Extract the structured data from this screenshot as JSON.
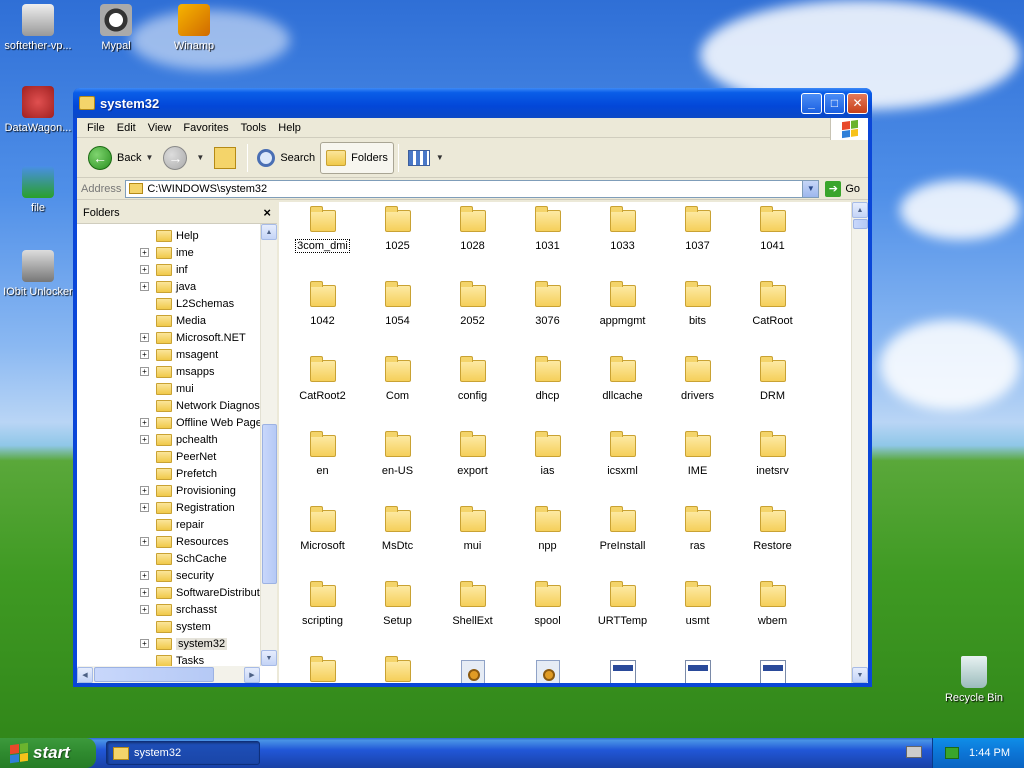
{
  "desktop": {
    "icons": [
      {
        "label": "softether-vp..."
      },
      {
        "label": "Mypal"
      },
      {
        "label": "Winamp"
      },
      {
        "label": "DataWagon..."
      },
      {
        "label": "file"
      },
      {
        "label": "IObit Unlocker"
      },
      {
        "label": "Recycle Bin"
      }
    ]
  },
  "window": {
    "title": "system32",
    "menu": [
      "File",
      "Edit",
      "View",
      "Favorites",
      "Tools",
      "Help"
    ],
    "toolbar": {
      "back": "Back",
      "search": "Search",
      "folders": "Folders"
    },
    "address": {
      "label": "Address",
      "value": "C:\\WINDOWS\\system32",
      "go": "Go"
    },
    "folders_pane": {
      "title": "Folders",
      "close": "×",
      "items": [
        {
          "label": "Help",
          "expandable": false
        },
        {
          "label": "ime",
          "expandable": true
        },
        {
          "label": "inf",
          "expandable": true
        },
        {
          "label": "java",
          "expandable": true
        },
        {
          "label": "L2Schemas",
          "expandable": false
        },
        {
          "label": "Media",
          "expandable": false
        },
        {
          "label": "Microsoft.NET",
          "expandable": true
        },
        {
          "label": "msagent",
          "expandable": true
        },
        {
          "label": "msapps",
          "expandable": true
        },
        {
          "label": "mui",
          "expandable": false
        },
        {
          "label": "Network Diagnost",
          "expandable": false
        },
        {
          "label": "Offline Web Page",
          "expandable": true
        },
        {
          "label": "pchealth",
          "expandable": true
        },
        {
          "label": "PeerNet",
          "expandable": false
        },
        {
          "label": "Prefetch",
          "expandable": false
        },
        {
          "label": "Provisioning",
          "expandable": true
        },
        {
          "label": "Registration",
          "expandable": true
        },
        {
          "label": "repair",
          "expandable": false
        },
        {
          "label": "Resources",
          "expandable": true
        },
        {
          "label": "SchCache",
          "expandable": false
        },
        {
          "label": "security",
          "expandable": true
        },
        {
          "label": "SoftwareDistribut",
          "expandable": true
        },
        {
          "label": "srchasst",
          "expandable": true
        },
        {
          "label": "system",
          "expandable": false
        },
        {
          "label": "system32",
          "expandable": true,
          "selected": true
        },
        {
          "label": "Tasks",
          "expandable": false
        }
      ]
    },
    "files": [
      [
        "3com_dmi",
        "1025",
        "1028",
        "1031",
        "1033",
        "1037",
        "1041"
      ],
      [
        "1042",
        "1054",
        "2052",
        "3076",
        "appmgmt",
        "bits",
        "CatRoot"
      ],
      [
        "CatRoot2",
        "Com",
        "config",
        "dhcp",
        "dllcache",
        "drivers",
        "DRM"
      ],
      [
        "en",
        "en-US",
        "export",
        "ias",
        "icsxml",
        "IME",
        "inetsrv"
      ],
      [
        "Microsoft",
        "MsDtc",
        "mui",
        "npp",
        "PreInstall",
        "ras",
        "Restore"
      ],
      [
        "scripting",
        "Setup",
        "ShellExt",
        "spool",
        "URTTemp",
        "usmt",
        "wbem"
      ]
    ]
  },
  "taskbar": {
    "start": "start",
    "task": "system32",
    "clock": "1:44 PM"
  },
  "colors": {
    "titlebar": "#0347d8",
    "taskbar": "#2157d7",
    "start": "#2f8a2f",
    "folder": "#f5cf5a"
  }
}
